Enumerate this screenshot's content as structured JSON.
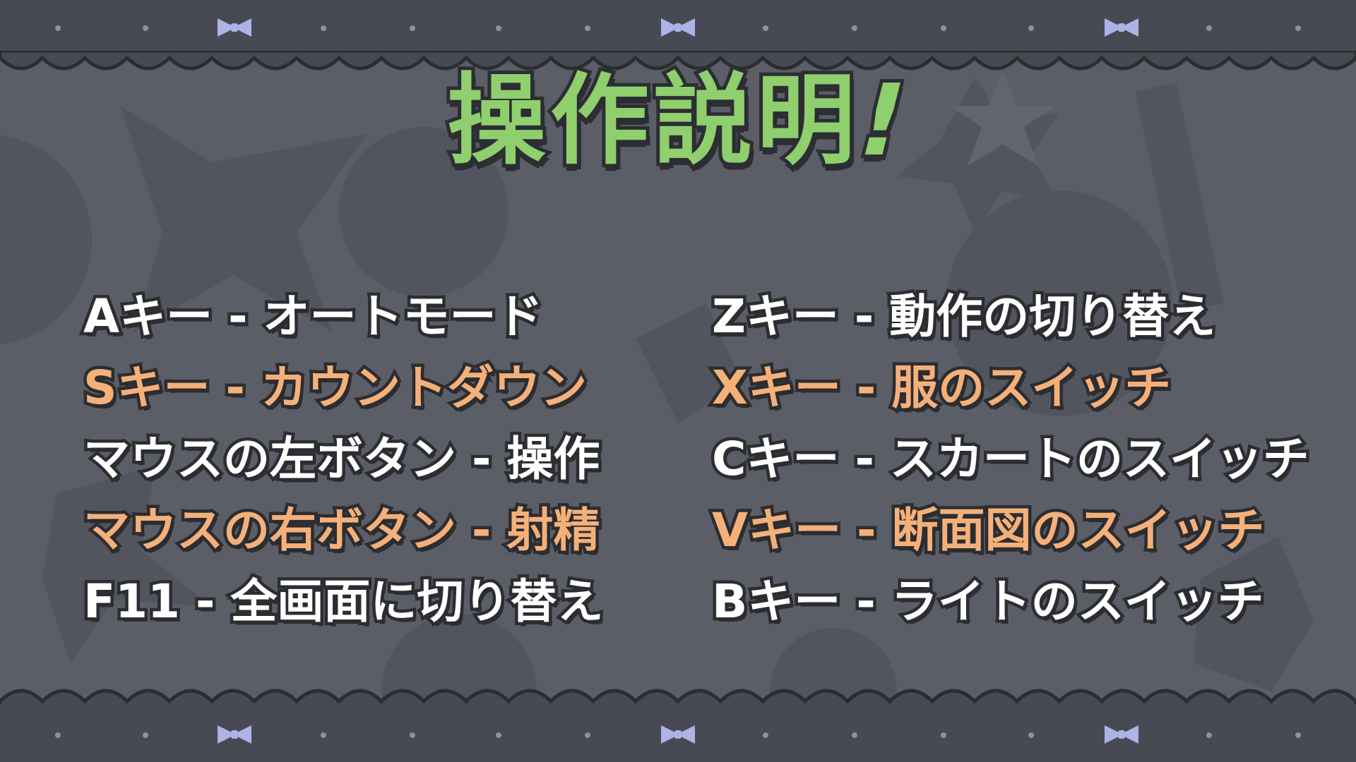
{
  "title": {
    "main": "操作説明",
    "exclaim": "!"
  },
  "colors": {
    "background": "#5b5e66",
    "band": "#474a52",
    "title_green": "#8fcf6e",
    "text_white": "#ffffff",
    "text_orange": "#f5b07a",
    "bow": "#aeb3e6"
  },
  "controls": {
    "left": [
      {
        "key": "Aキー",
        "sep": "-",
        "action": "オートモード",
        "color": "white"
      },
      {
        "key": "Sキー",
        "sep": "-",
        "action": "カウントダウン",
        "color": "orange"
      },
      {
        "key": "マウスの左ボタン",
        "sep": "-",
        "action": "操作",
        "color": "white"
      },
      {
        "key": "マウスの右ボタン",
        "sep": "-",
        "action": "射精",
        "color": "orange"
      },
      {
        "key": "F11",
        "sep": "-",
        "action": "全画面に切り替え",
        "color": "white"
      }
    ],
    "right": [
      {
        "key": "Zキー",
        "sep": "-",
        "action": "動作の切り替え",
        "color": "white"
      },
      {
        "key": "Xキー",
        "sep": "-",
        "action": "服のスイッチ",
        "color": "orange"
      },
      {
        "key": "Cキー",
        "sep": "-",
        "action": "スカートのスイッチ",
        "color": "white"
      },
      {
        "key": "Vキー",
        "sep": "-",
        "action": "断面図のスイッチ",
        "color": "orange"
      },
      {
        "key": "Bキー",
        "sep": "-",
        "action": "ライトのスイッチ",
        "color": "white"
      }
    ]
  }
}
